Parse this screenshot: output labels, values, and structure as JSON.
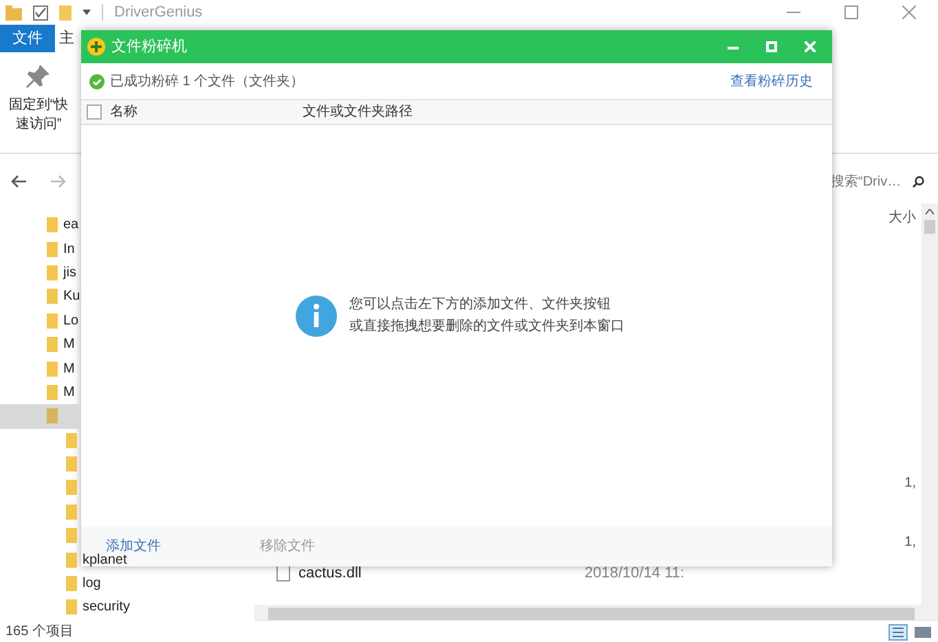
{
  "explorer": {
    "title": "DriverGenius",
    "ribbon_tabs": [
      {
        "label": "文件",
        "selected": true
      },
      {
        "label": "主",
        "selected": false
      }
    ],
    "pin_button": "固定到“快速访问”",
    "search": {
      "placeholder": "搜索“Driv…"
    },
    "size_header": "大小",
    "nav_tree": [
      {
        "label": "ea",
        "selected": false
      },
      {
        "label": "In",
        "selected": false
      },
      {
        "label": "jis",
        "selected": false
      },
      {
        "label": "Ku",
        "selected": false
      },
      {
        "label": "Lo",
        "selected": false
      },
      {
        "label": "M",
        "selected": false
      },
      {
        "label": "M",
        "selected": false
      },
      {
        "label": "M",
        "selected": false
      },
      {
        "selected": true,
        "children": [
          {
            "selected": false
          },
          {
            "selected": false
          },
          {
            "selected": false
          },
          {
            "selected": false
          },
          {
            "selected": false
          },
          {
            "label": "kplanet",
            "selected": false
          },
          {
            "label": "log",
            "selected": false
          },
          {
            "label": "security",
            "selected": false
          }
        ]
      }
    ],
    "sizes": [
      "1,",
      "1,"
    ],
    "files": [
      {
        "name": "cactus.dll",
        "date": "2018/10/14 11:"
      }
    ],
    "status_bar": "165 个项目"
  },
  "dialog": {
    "title": "文件粉碎机",
    "status": "已成功粉碎 1 个文件（文件夹）",
    "history_link": "查看粉碎历史",
    "select_all": {
      "checked": false
    },
    "columns": [
      "名称",
      "文件或文件夹路径"
    ],
    "empty_message": [
      "您可以点击左下方的添加文件、文件夹按钮",
      "或直接拖拽想要删除的文件或文件夹到本窗口"
    ],
    "footer_buttons": [
      {
        "label": "添加文件",
        "disabled": false
      },
      {
        "label": "移除文件",
        "disabled": true
      }
    ]
  }
}
